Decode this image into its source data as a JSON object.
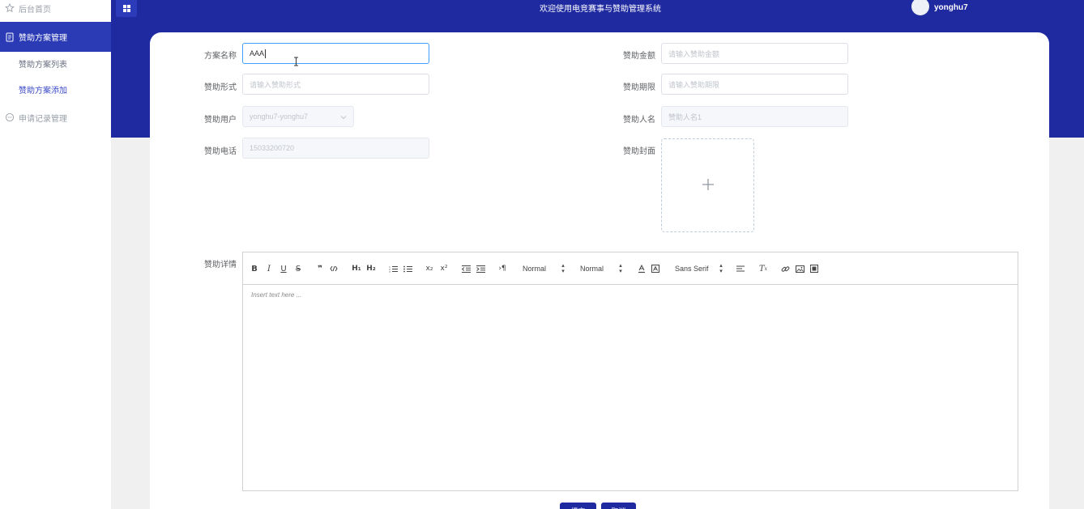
{
  "sidebar": {
    "home_label": "后台首页",
    "group_label": "赞助方案管理",
    "sub_items": [
      {
        "label": "赞助方案列表"
      },
      {
        "label": "赞助方案添加"
      }
    ],
    "apply_label": "申请记录管理"
  },
  "header": {
    "title": "欢迎使用电竞赛事与赞助管理系统",
    "username": "yonghu7"
  },
  "form": {
    "plan_name": {
      "label": "方案名称",
      "value": "AAA"
    },
    "amount": {
      "label": "赞助金额",
      "placeholder": "请输入赞助金额"
    },
    "form_type": {
      "label": "赞助形式",
      "placeholder": "请输入赞助形式"
    },
    "period": {
      "label": "赞助期限",
      "placeholder": "请输入赞助期限"
    },
    "user": {
      "label": "赞助用户",
      "value": "yonghu7-yonghu7"
    },
    "sponsor_name": {
      "label": "赞助人名",
      "placeholder": "赞助人名1"
    },
    "phone": {
      "label": "赞助电话",
      "value": "15033200720"
    },
    "cover": {
      "label": "赞助封面"
    },
    "detail": {
      "label": "赞助详情"
    }
  },
  "editor": {
    "header_picker": "Normal",
    "size_picker": "Normal",
    "font_picker": "Sans Serif",
    "placeholder": "Insert text here ..."
  },
  "buttons": {
    "submit": "提交",
    "cancel": "取消"
  },
  "colors": {
    "primary": "#1f2aa1",
    "sidebar_active": "#2a3bb5",
    "focus_border": "#409eff"
  }
}
